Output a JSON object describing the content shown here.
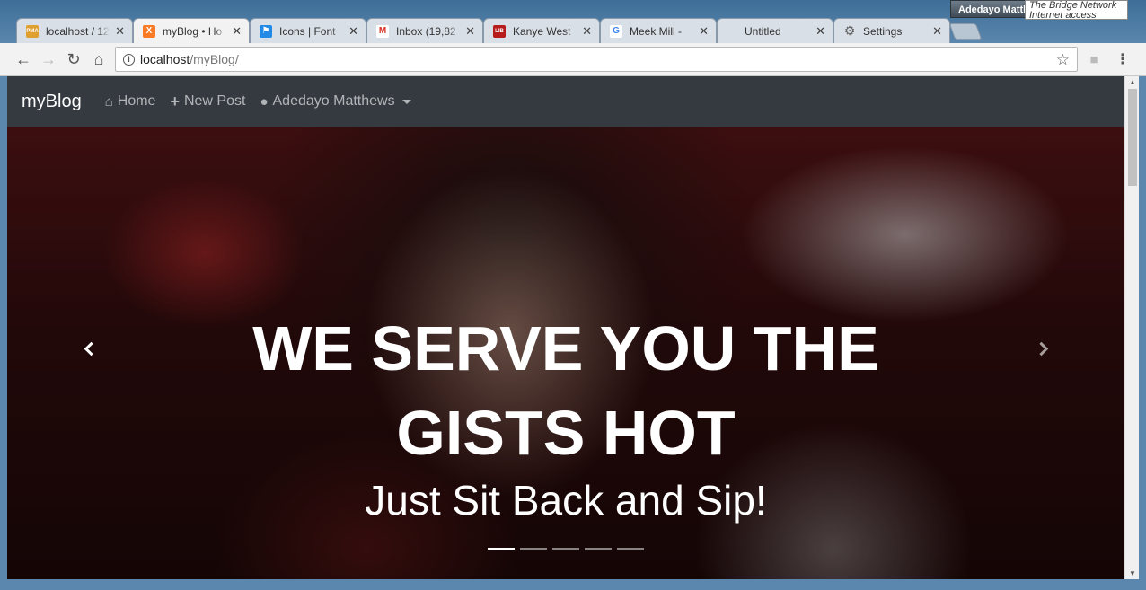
{
  "browser": {
    "tabs": [
      {
        "title": "localhost / 12",
        "icon": "phpmyadmin-icon",
        "icon_text": "PMA",
        "color": "#e0a030"
      },
      {
        "title": "myBlog • Ho",
        "icon": "xampp-icon",
        "icon_text": "X",
        "color": "#fb7a24"
      },
      {
        "title": "Icons | Font",
        "icon": "flag-icon",
        "icon_text": "⚑",
        "color": "#228ae6"
      },
      {
        "title": "Inbox (19,82",
        "icon": "gmail-icon",
        "icon_text": "M",
        "color": "#d93025"
      },
      {
        "title": "Kanye West",
        "icon": "lib-icon",
        "icon_text": "LIB",
        "color": "#b71c1c"
      },
      {
        "title": "Meek Mill -",
        "icon": "google-icon",
        "icon_text": "G",
        "color": "#4285f4"
      },
      {
        "title": "Untitled",
        "icon": "",
        "icon_text": "",
        "color": ""
      },
      {
        "title": "Settings",
        "icon": "gear-icon",
        "icon_text": "⚙",
        "color": "#666666"
      }
    ],
    "profile_name": "Adedayo Matth",
    "tooltip_line1": "The Bridge Network",
    "tooltip_line2": "Internet access",
    "url_host": "localhost",
    "url_path": "/myBlog/"
  },
  "navbar": {
    "brand": "myBlog",
    "home": "Home",
    "new_post": "New Post",
    "user": "Adedayo Matthews"
  },
  "hero": {
    "headline": "WE SERVE YOU THE GISTS HOT",
    "subheadline": "Just Sit Back and Sip!",
    "slide_count": 5,
    "active_slide": 1
  }
}
